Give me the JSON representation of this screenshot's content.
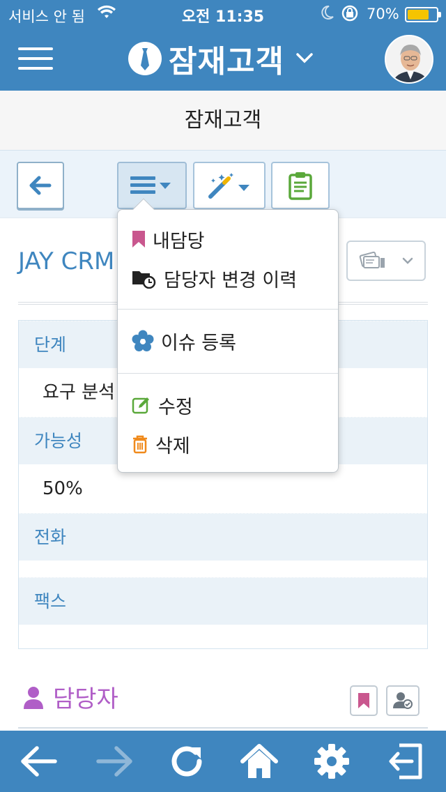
{
  "status_bar": {
    "carrier": "서비스 안 됨",
    "time": "오전 11:35",
    "battery": "70%"
  },
  "nav": {
    "title": "잠재고객"
  },
  "subheader": {
    "title": "잠재고객"
  },
  "record": {
    "title": "JAY CRM"
  },
  "fields": [
    {
      "label": "단계",
      "value": "요구 분석"
    },
    {
      "label": "가능성",
      "value": "50%"
    },
    {
      "label": "전화",
      "value": ""
    },
    {
      "label": "팩스",
      "value": ""
    }
  ],
  "owner_section": {
    "label": "담당자"
  },
  "menu": {
    "items": [
      {
        "label": "내담당",
        "icon": "bookmark-icon"
      },
      {
        "label": "담당자 변경 이력",
        "icon": "folder-history-icon"
      },
      {
        "label": "이슈 등록",
        "icon": "flower-icon"
      },
      {
        "label": "수정",
        "icon": "edit-icon"
      },
      {
        "label": "삭제",
        "icon": "trash-icon"
      }
    ]
  },
  "colors": {
    "primary": "#3f86bf",
    "bookmark": "#c9578e",
    "owner": "#b05ec7",
    "edit": "#5aa83a",
    "delete": "#f08a1c",
    "issue": "#3f86bf"
  }
}
